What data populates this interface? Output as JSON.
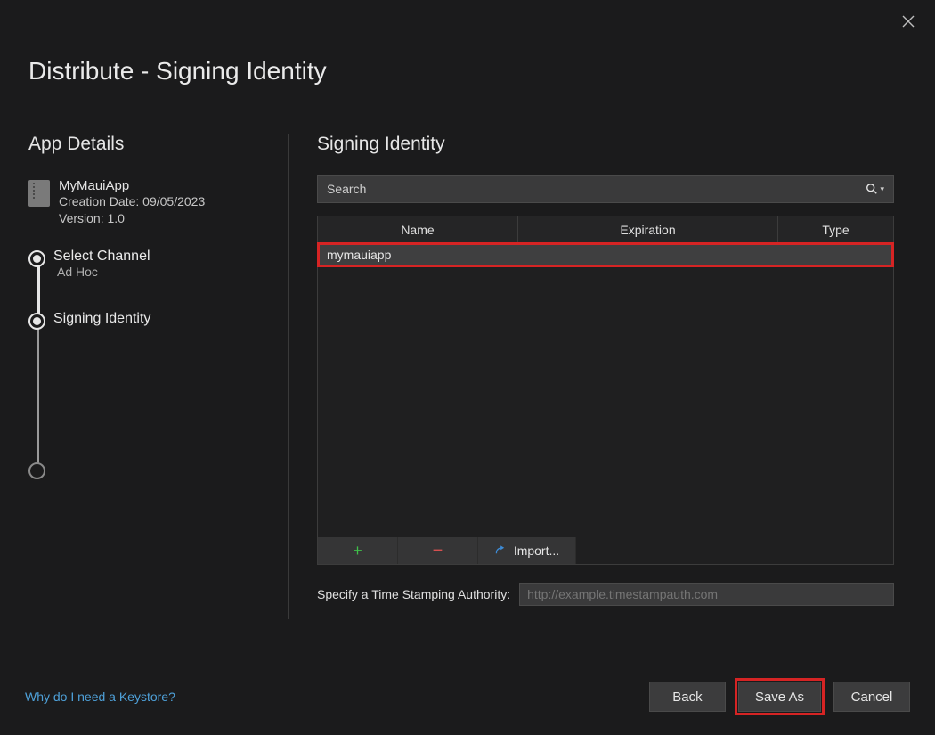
{
  "window": {
    "title": "Distribute - Signing Identity"
  },
  "left": {
    "header": "App Details",
    "app": {
      "name": "MyMauiApp",
      "creation_label": "Creation Date: 09/05/2023",
      "version_label": "Version: 1.0"
    },
    "steps": [
      {
        "label": "Select Channel",
        "sub": "Ad Hoc",
        "active": true
      },
      {
        "label": "Signing Identity",
        "sub": "",
        "active": true
      },
      {
        "label": "",
        "sub": "",
        "active": false
      }
    ]
  },
  "right": {
    "header": "Signing Identity",
    "search_placeholder": "Search",
    "columns": {
      "name": "Name",
      "expiration": "Expiration",
      "type": "Type"
    },
    "rows": [
      {
        "name": "mymauiapp",
        "expiration": "",
        "type": ""
      }
    ],
    "toolbar": {
      "import_label": "Import..."
    },
    "tsa": {
      "label": "Specify a Time Stamping Authority:",
      "placeholder": "http://example.timestampauth.com",
      "value": ""
    }
  },
  "footer": {
    "help_link": "Why do I need a Keystore?",
    "back": "Back",
    "save_as": "Save As",
    "cancel": "Cancel"
  }
}
